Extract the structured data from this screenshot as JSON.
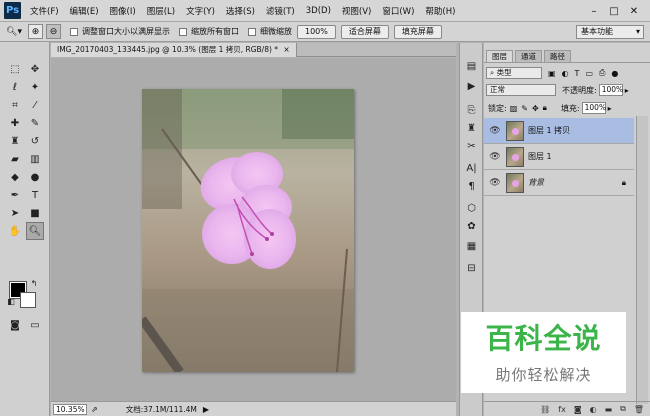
{
  "app": {
    "logo": "Ps"
  },
  "menu": [
    "文件(F)",
    "编辑(E)",
    "图像(I)",
    "图层(L)",
    "文字(Y)",
    "选择(S)",
    "滤镜(T)",
    "3D(D)",
    "视图(V)",
    "窗口(W)",
    "帮助(H)"
  ],
  "window_controls": [
    "–",
    "□",
    "✕"
  ],
  "options": {
    "resize_windows": "调整窗口大小以满屏显示",
    "zoom_all": "缩放所有窗口",
    "scrubby_zoom": "细微缩放",
    "zoom_100": "100%",
    "fit_screen": "适合屏幕",
    "fill_screen": "填充屏幕",
    "workspace": "基本功能"
  },
  "document": {
    "tab_title": "IMG_20170403_133445.jpg @ 10.3% (图层 1 拷贝, RGB/8) *",
    "zoom": "10.35%",
    "size": "文档:37.1M/111.4M"
  },
  "layers_panel": {
    "tabs": [
      "图层",
      "通道",
      "路径"
    ],
    "filter_kind": "类型",
    "blend_mode": "正常",
    "opacity_label": "不透明度:",
    "opacity_value": "100%",
    "lock_label": "锁定:",
    "fill_label": "填充:",
    "fill_value": "100%",
    "layers": [
      {
        "name": "图层 1 拷贝",
        "selected": true
      },
      {
        "name": "图层 1",
        "selected": false
      },
      {
        "name": "背景",
        "selected": false,
        "locked": true
      }
    ],
    "bottom_icons": [
      "link-icon",
      "fx-icon",
      "mask-icon",
      "adjustment-icon",
      "group-icon",
      "new-layer-icon",
      "trash-icon"
    ]
  },
  "watermark": {
    "title": "百科全说",
    "subtitle": "助你轻松解决"
  },
  "colors": {
    "accent_green": "#3bb54a",
    "selection_blue": "#a9bde3",
    "foreground": "#000000",
    "background": "#ffffff"
  }
}
